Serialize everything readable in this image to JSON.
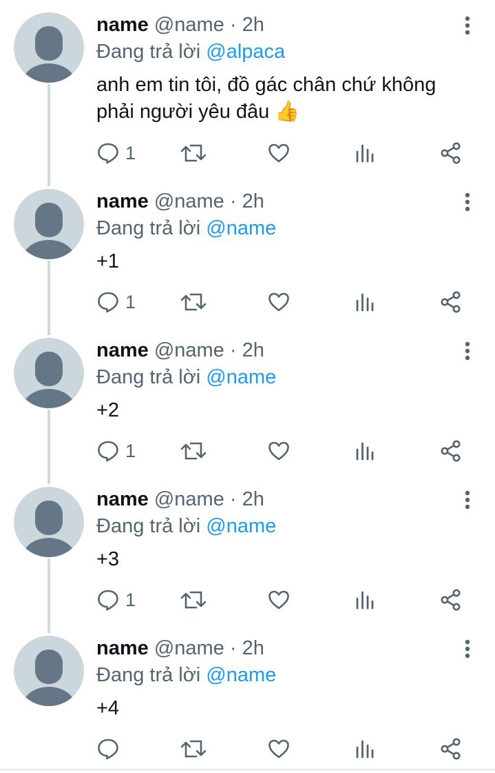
{
  "tweets": [
    {
      "display_name": "name",
      "handle": "@name",
      "separator": "·",
      "time": "2h",
      "reply_prefix": "Đang trả lời",
      "reply_to": "@alpaca",
      "text": "anh em tin tôi, đồ gác chân chứ không\nphải người yêu đâu 👍",
      "reply_count": "1"
    },
    {
      "display_name": "name",
      "handle": "@name",
      "separator": "·",
      "time": "2h",
      "reply_prefix": "Đang trả lời",
      "reply_to": "@name",
      "text": "+1",
      "reply_count": "1"
    },
    {
      "display_name": "name",
      "handle": "@name",
      "separator": "·",
      "time": "2h",
      "reply_prefix": "Đang trả lời",
      "reply_to": "@name",
      "text": "+2",
      "reply_count": "1"
    },
    {
      "display_name": "name",
      "handle": "@name",
      "separator": "·",
      "time": "2h",
      "reply_prefix": "Đang trả lời",
      "reply_to": "@name",
      "text": "+3",
      "reply_count": "1"
    },
    {
      "display_name": "name",
      "handle": "@name",
      "separator": "·",
      "time": "2h",
      "reply_prefix": "Đang trả lời",
      "reply_to": "@name",
      "text": "+4",
      "reply_count": ""
    }
  ],
  "icons": {
    "reply": "reply-icon",
    "retweet": "retweet-icon",
    "like": "heart-icon",
    "views": "analytics-icon",
    "share": "share-icon",
    "more": "more-vertical-icon"
  },
  "colors": {
    "text_primary": "#0f1419",
    "text_secondary": "#536471",
    "accent": "#1d9bf0",
    "thread_line": "#cfd9de",
    "avatar_bg": "#ccd6dd",
    "avatar_figure": "#657786"
  }
}
